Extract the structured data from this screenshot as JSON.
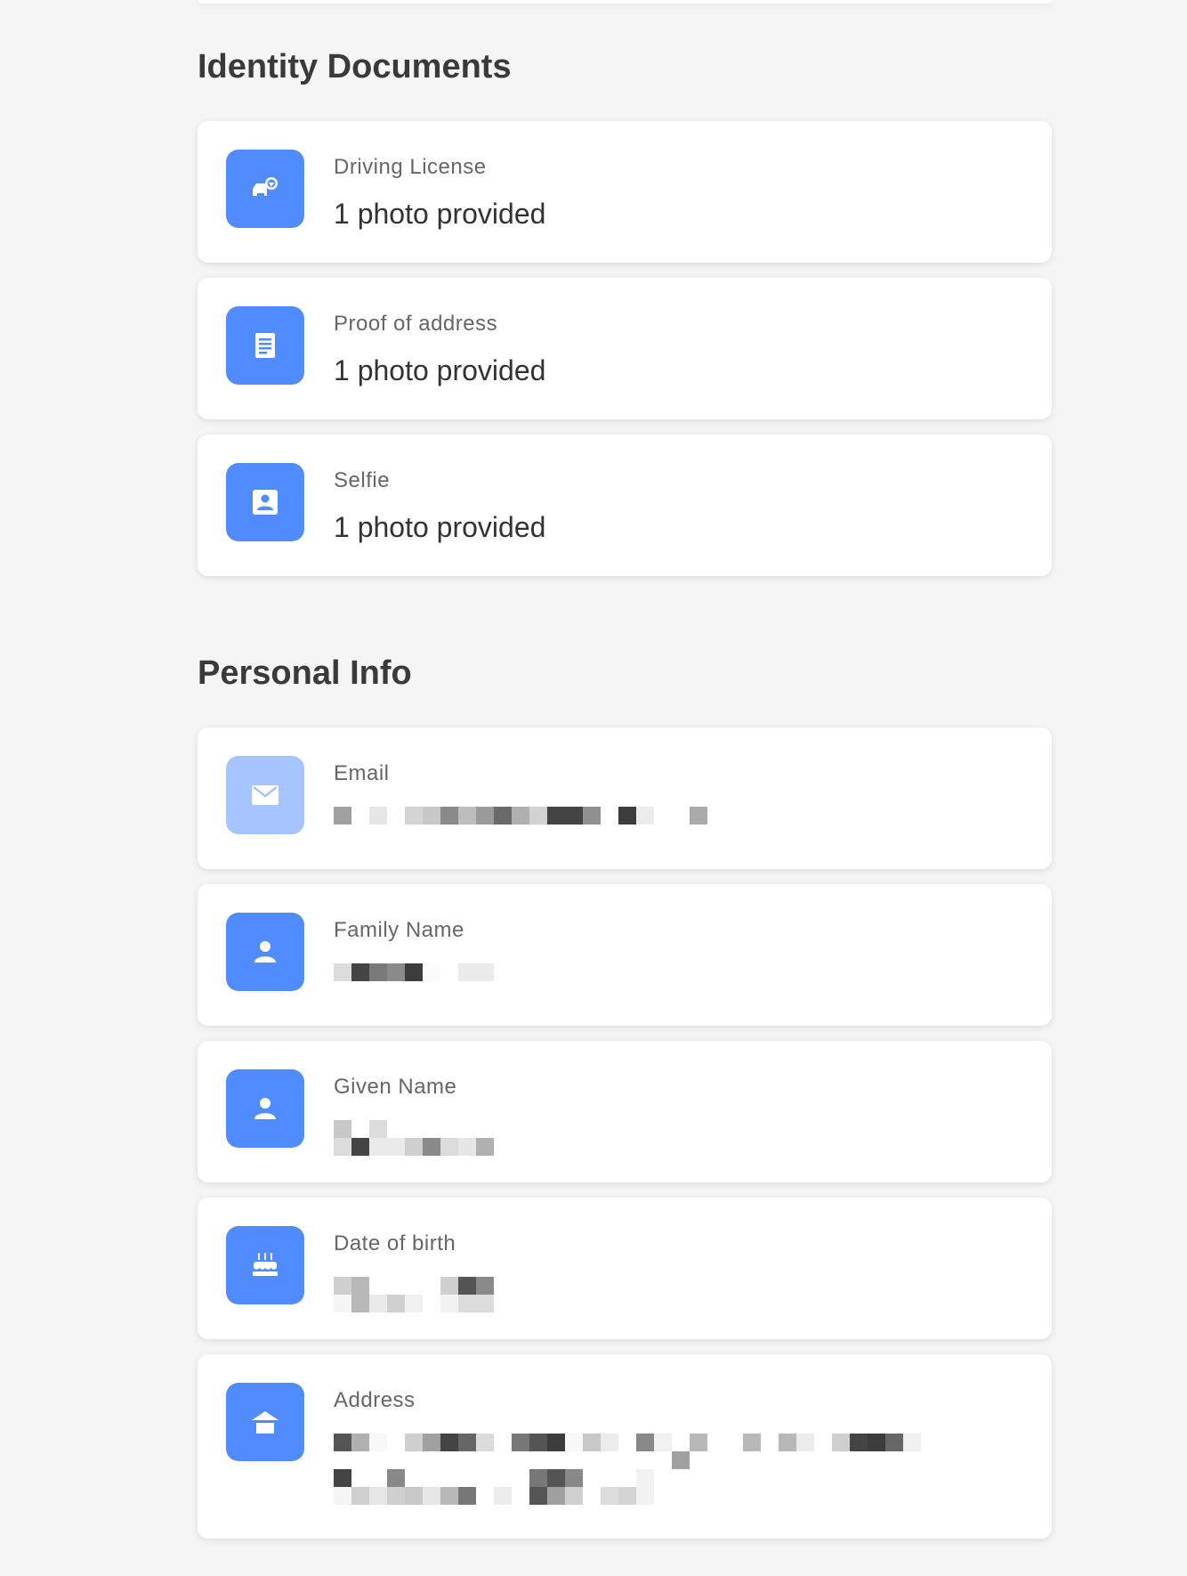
{
  "sections": {
    "identity": {
      "title": "Identity Documents",
      "items": [
        {
          "label": "Driving License",
          "value": "1 photo provided",
          "icon": "car-license-icon"
        },
        {
          "label": "Proof of address",
          "value": "1 photo provided",
          "icon": "document-icon"
        },
        {
          "label": "Selfie",
          "value": "1 photo provided",
          "icon": "portrait-icon"
        }
      ]
    },
    "personal": {
      "title": "Personal Info",
      "items": [
        {
          "label": "Email",
          "value_redacted": true,
          "icon": "mail-icon"
        },
        {
          "label": "Family Name",
          "value_redacted": true,
          "icon": "person-icon"
        },
        {
          "label": "Given Name",
          "value_redacted": true,
          "icon": "person-icon"
        },
        {
          "label": "Date of birth",
          "value_redacted": true,
          "icon": "cake-icon"
        },
        {
          "label": "Address",
          "value_redacted": true,
          "icon": "house-icon"
        }
      ]
    }
  },
  "colors": {
    "accent": "#518cff",
    "accent_light": "#a6c4ff",
    "background": "#f5f5f5",
    "card": "#ffffff"
  }
}
